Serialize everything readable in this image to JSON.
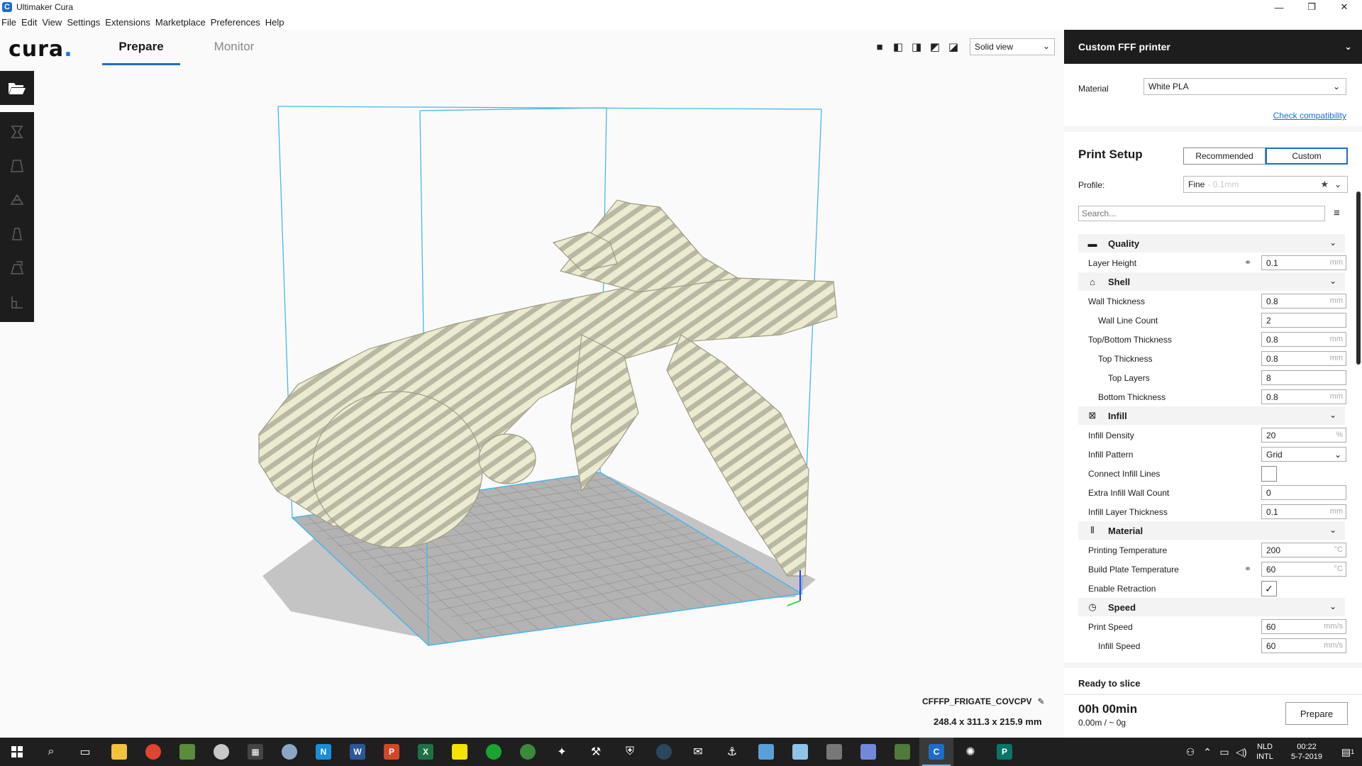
{
  "window": {
    "title": "Ultimaker Cura",
    "controls": {
      "minimize": "—",
      "restore": "❐",
      "close": "✕"
    }
  },
  "menu": [
    "File",
    "Edit",
    "View",
    "Settings",
    "Extensions",
    "Marketplace",
    "Preferences",
    "Help"
  ],
  "header": {
    "logo": "cura",
    "stages": [
      "Prepare",
      "Monitor"
    ],
    "view_mode": "Solid view"
  },
  "viewport": {
    "model_name": "CFFFP_FRIGATE_COVCPV",
    "model_dimensions": "248.4 x 311.3 x 215.9 mm"
  },
  "printer": {
    "name": "Custom FFF printer",
    "material_label": "Material",
    "material": "White PLA",
    "check_compatibility": "Check compatibility"
  },
  "print_setup": {
    "title": "Print Setup",
    "modes": [
      "Recommended",
      "Custom"
    ],
    "active_mode": "Custom",
    "profile_label": "Profile:",
    "profile": "Fine",
    "profile_sub": "- 0.1mm",
    "search_placeholder": "Search..."
  },
  "settings": {
    "quality": {
      "label": "Quality",
      "layer_height": {
        "label": "Layer Height",
        "value": "0.1",
        "unit": "mm"
      }
    },
    "shell": {
      "label": "Shell",
      "wall_thickness": {
        "label": "Wall Thickness",
        "value": "0.8",
        "unit": "mm"
      },
      "wall_line_count": {
        "label": "Wall Line Count",
        "value": "2"
      },
      "top_bottom_thickness": {
        "label": "Top/Bottom Thickness",
        "value": "0.8",
        "unit": "mm"
      },
      "top_thickness": {
        "label": "Top Thickness",
        "value": "0.8",
        "unit": "mm"
      },
      "top_layers": {
        "label": "Top Layers",
        "value": "8"
      },
      "bottom_thickness": {
        "label": "Bottom Thickness",
        "value": "0.8",
        "unit": "mm"
      }
    },
    "infill": {
      "label": "Infill",
      "infill_density": {
        "label": "Infill Density",
        "value": "20",
        "unit": "%"
      },
      "infill_pattern": {
        "label": "Infill Pattern",
        "value": "Grid"
      },
      "connect_infill_lines": {
        "label": "Connect Infill Lines",
        "checked": false
      },
      "extra_infill_wall_count": {
        "label": "Extra Infill Wall Count",
        "value": "0"
      },
      "infill_layer_thickness": {
        "label": "Infill Layer Thickness",
        "value": "0.1",
        "unit": "mm"
      }
    },
    "material": {
      "label": "Material",
      "printing_temperature": {
        "label": "Printing Temperature",
        "value": "200",
        "unit": "°C"
      },
      "build_plate_temperature": {
        "label": "Build Plate Temperature",
        "value": "60",
        "unit": "°C"
      },
      "enable_retraction": {
        "label": "Enable Retraction",
        "checked": true
      }
    },
    "speed": {
      "label": "Speed",
      "print_speed": {
        "label": "Print Speed",
        "value": "60",
        "unit": "mm/s"
      },
      "infill_speed": {
        "label": "Infill Speed",
        "value": "60",
        "unit": "mm/s"
      }
    }
  },
  "slice": {
    "status": "Ready to slice",
    "time": "00h 00min",
    "estimate": "0.00m / ~ 0g",
    "button": "Prepare"
  },
  "taskbar": {
    "lang_top": "NLD",
    "lang_bottom": "INTL",
    "time": "00:22",
    "date": "5-7-2019",
    "notification_count": "1"
  },
  "colors": {
    "accent": "#1d6dc7",
    "dark": "#1d1d1d",
    "build_volume": "#49b6e8",
    "model": "#e6e6c7"
  }
}
